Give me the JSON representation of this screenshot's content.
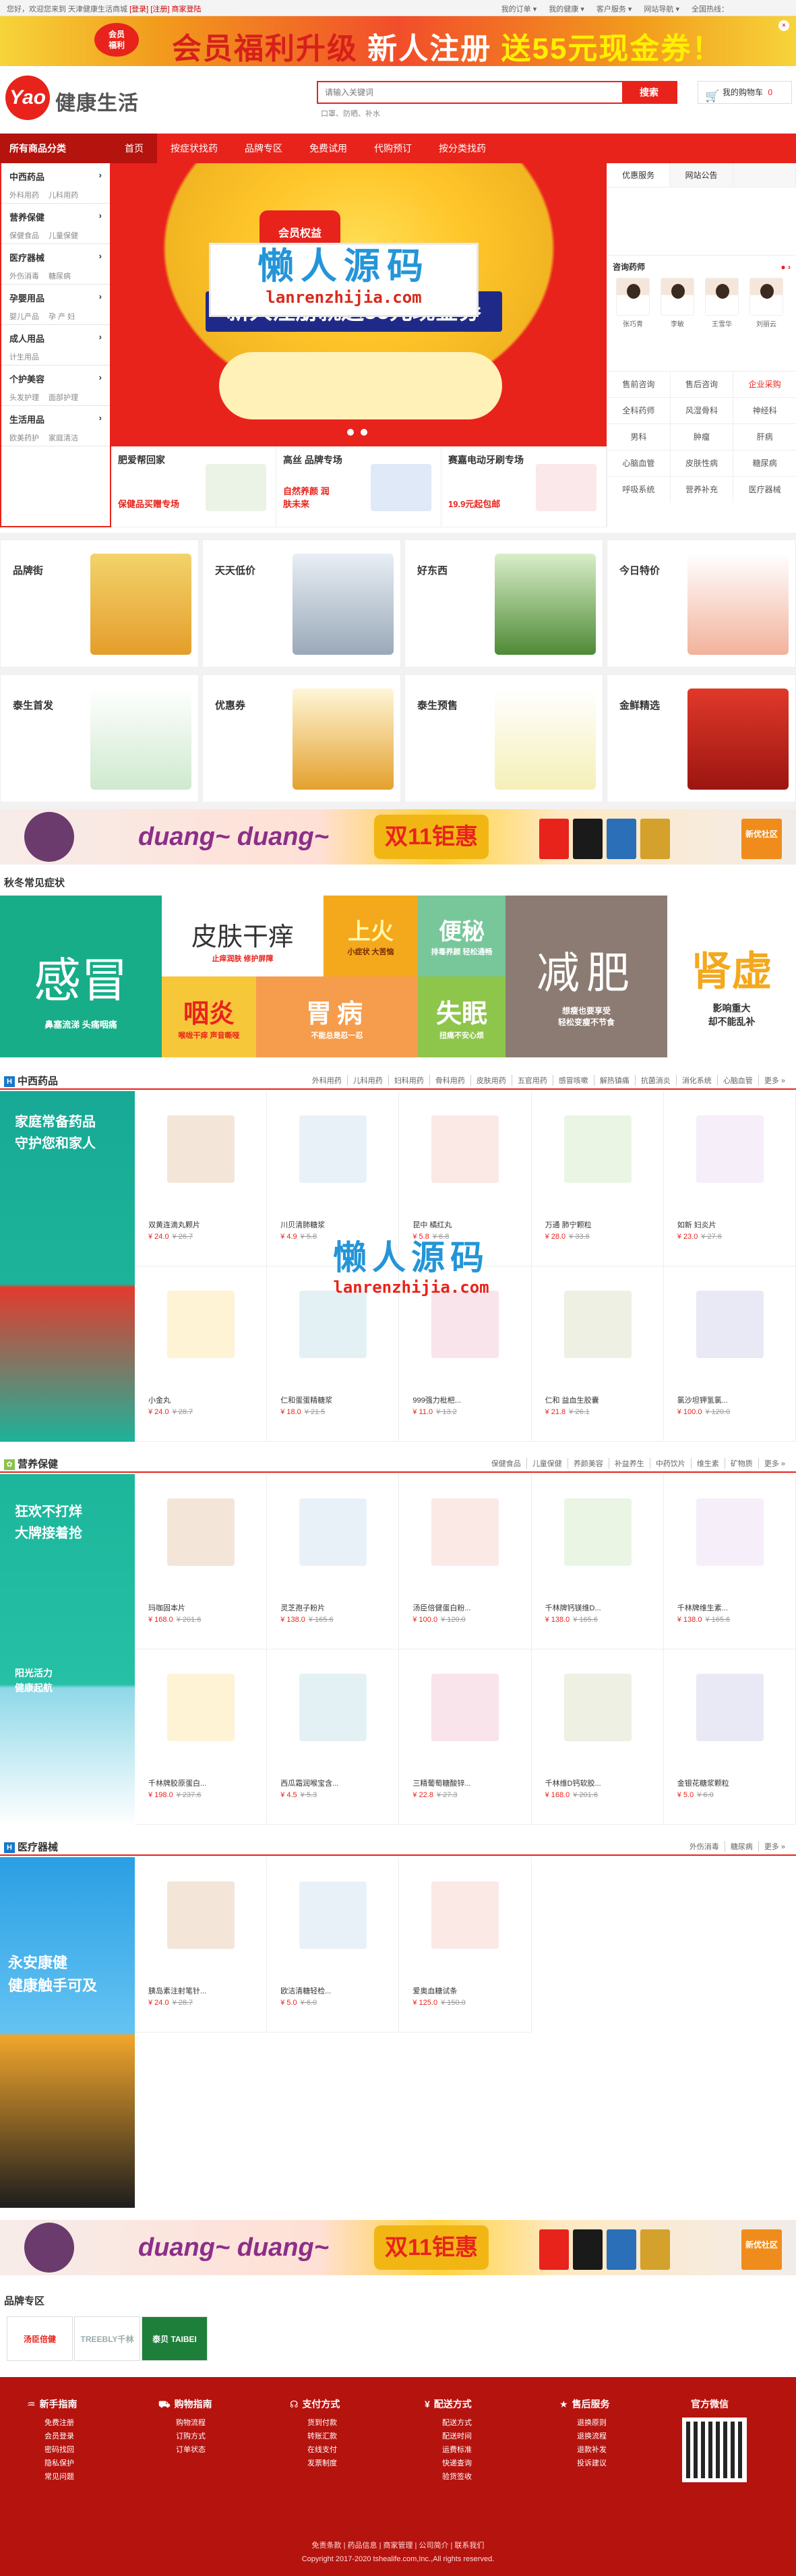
{
  "topbar": {
    "welcome_pre": "您好，欢迎您来到 天津健康生活商城 ",
    "login": "[登录]",
    "register": "[注册]",
    "home": "商家登陆",
    "links": [
      "我的订单 ▾",
      "我的健康 ▾",
      "客户服务 ▾",
      "网站导航 ▾",
      "全国热线："
    ]
  },
  "promo": {
    "badge": "会员\n福利",
    "text_a": "会员福利升级",
    "text_b": "新人注册",
    "text_c": "送55元现金券！",
    "close": "×"
  },
  "header": {
    "logo_mark": "Yao",
    "logo_text": "健康生活",
    "search_placeholder": "请输入关键词",
    "search_button": "搜索",
    "hot_words": "口罩、防晒、补水",
    "cart": "我的购物车",
    "cart_count": "0"
  },
  "nav": {
    "all": "所有商品分类",
    "items": [
      "首页",
      "按症状找药",
      "品牌专区",
      "免费试用",
      "代购预订",
      "按分类找药"
    ]
  },
  "sidebar": [
    {
      "title": "中西药品",
      "subs": [
        "外科用药",
        "儿科用药"
      ]
    },
    {
      "title": "营养保健",
      "subs": [
        "保健食品",
        "儿童保健"
      ]
    },
    {
      "title": "医疗器械",
      "subs": [
        "外伤消毒",
        "糖尿病"
      ]
    },
    {
      "title": "孕婴用品",
      "subs": [
        "婴儿产品",
        "孕 产 妇"
      ]
    },
    {
      "title": "成人用品",
      "subs": [
        "计生用品"
      ]
    },
    {
      "title": "个护美容",
      "subs": [
        "头发护理",
        "面部护理"
      ]
    },
    {
      "title": "生活用品",
      "subs": [
        "欧美药护",
        "家庭清洁"
      ]
    }
  ],
  "banner": {
    "ribbon": "会员权益\n大升级",
    "headline": "新人注册就送55元现金券",
    "watermark_cn": "懒人源码",
    "watermark_url": "lanrenzhijia.com"
  },
  "subbanners": [
    {
      "title": "肥爱帮回家",
      "desc": "保健品买赠专场"
    },
    {
      "title": "高丝 品牌专场",
      "desc": "自然养颜 润肤未来"
    },
    {
      "title": "赛嘉电动牙刷专场",
      "desc": "19.9元起包邮"
    }
  ],
  "rightpanel": {
    "tabs": [
      "优惠服务",
      "网站公告",
      ""
    ],
    "pharm_title": "咨询药师",
    "doctors": [
      "张巧青",
      "李敏",
      "王雪华",
      "刘丽云"
    ],
    "grid": [
      [
        "售前咨询",
        "售后咨询",
        "企业采购"
      ],
      [
        "全科药师",
        "风湿骨科",
        "神经科"
      ],
      [
        "男科",
        "肿瘤",
        "肝病"
      ],
      [
        "心脑血管",
        "皮肤性病",
        "糖尿病"
      ],
      [
        "呼吸系统",
        "营养补充",
        "医疗器械"
      ]
    ]
  },
  "channels": [
    {
      "title": "品牌街"
    },
    {
      "title": "天天低价"
    },
    {
      "title": "好东西"
    },
    {
      "title": "今日特价"
    },
    {
      "title": "泰生首发"
    },
    {
      "title": "优惠券"
    },
    {
      "title": "泰生预售"
    },
    {
      "title": "金鲜精选"
    }
  ],
  "banner2": {
    "text": "duang~ duang~",
    "big": "双11钜惠",
    "tag": "新优社区"
  },
  "autumn": {
    "title": "秋冬常见症状",
    "blocks": [
      {
        "name": "感冒",
        "sub": "鼻塞流涕 头痛咽痛"
      },
      {
        "name": "皮肤干痒",
        "sub": "止痒润肤 修护屏障"
      },
      {
        "name": "上火",
        "sub": "小症状 大苦恼"
      },
      {
        "name": "便秘",
        "sub": "排毒养颜 轻松通畅"
      },
      {
        "name": "减肥",
        "sub": "想瘦也要享受\n轻松变瘦不节食"
      },
      {
        "name": "肾虚",
        "sub": "影响重大\n却不能乱补"
      },
      {
        "name": "咽炎",
        "sub": "喉咙干痒 声音嘶哑"
      },
      {
        "name": "胃病",
        "sub": "不能总是忍一忍"
      },
      {
        "name": "失眠",
        "sub": "扭痛不安心烦"
      }
    ]
  },
  "sec_cn": {
    "title": "中西药品",
    "icon": "H",
    "links": [
      "外科用药",
      "儿科用药",
      "妇科用药",
      "骨科用药",
      "皮肤用药",
      "五官用药",
      "感冒咳嗽",
      "解热镇痛",
      "抗菌消炎",
      "消化系统",
      "心脑血管",
      "更多 »"
    ],
    "banner": "家庭常备药品\n守护您和家人",
    "products": [
      {
        "name": "双黄连滴丸颗片",
        "price": "¥ 24.0",
        "old": "¥ 26.7"
      },
      {
        "name": "川贝清肺糖浆",
        "price": "¥ 4.9",
        "old": "¥ 5.8"
      },
      {
        "name": "昆中 橘红丸",
        "price": "¥ 5.8",
        "old": "¥ 6.8"
      },
      {
        "name": "万通 肺宁颗粒",
        "price": "¥ 28.0",
        "old": "¥ 33.6"
      },
      {
        "name": "如新 妇炎片",
        "price": "¥ 23.0",
        "old": "¥ 27.6"
      },
      {
        "name": "小金丸",
        "price": "¥ 24.0",
        "old": "¥ 28.7"
      },
      {
        "name": "仁和蛋蛋精糖浆",
        "price": "¥ 18.0",
        "old": "¥ 21.5"
      },
      {
        "name": "999强力枇杷...",
        "price": "¥ 11.0",
        "old": "¥ 13.2"
      },
      {
        "name": "仁和 益血生胶囊",
        "price": "¥ 21.8",
        "old": "¥ 26.1"
      },
      {
        "name": "氯沙坦钾氢氯...",
        "price": "¥ 100.0",
        "old": "¥ 120.0"
      }
    ]
  },
  "sec_yy": {
    "title": "营养保健",
    "links": [
      "保健食品",
      "儿童保健",
      "养颜美容",
      "补益养生",
      "中药饮片",
      "维生素",
      "矿物质",
      "更多 »"
    ],
    "banner_top": "狂欢不打烊\n大牌接着抢",
    "banner_bot": "阳光活力\n健康起航",
    "products": [
      {
        "name": "玛咖固本片",
        "price": "¥ 168.0",
        "old": "¥ 201.6"
      },
      {
        "name": "灵芝孢子粉片",
        "price": "¥ 138.0",
        "old": "¥ 165.6"
      },
      {
        "name": "汤臣倍健蛋白粉...",
        "price": "¥ 100.0",
        "old": "¥ 120.0"
      },
      {
        "name": "千林牌钙镁维D...",
        "price": "¥ 138.0",
        "old": "¥ 165.6"
      },
      {
        "name": "千林牌维生素...",
        "price": "¥ 138.0",
        "old": "¥ 165.6"
      },
      {
        "name": "千林牌胶原蛋白...",
        "price": "¥ 198.0",
        "old": "¥ 237.6"
      },
      {
        "name": "西瓜霜润喉宝含...",
        "price": "¥ 4.5",
        "old": "¥ 5.3"
      },
      {
        "name": "三精葡萄糖酸锌...",
        "price": "¥ 22.8",
        "old": "¥ 27.3"
      },
      {
        "name": "千林维D钙软胶...",
        "price": "¥ 168.0",
        "old": "¥ 201.6"
      },
      {
        "name": "金银花糖浆颗粒",
        "price": "¥ 5.0",
        "old": "¥ 6.0"
      }
    ]
  },
  "sec_yl": {
    "title": "医疗器械",
    "icon": "H",
    "links": [
      "外伤消毒",
      "糖尿病",
      "更多 »"
    ],
    "banner": "永安康健\n健康触手可及",
    "products": [
      {
        "name": "胰岛素注射笔针...",
        "price": "¥ 24.0",
        "old": "¥ 28.7"
      },
      {
        "name": "欧洁清糖轻检...",
        "price": "¥ 5.0",
        "old": "¥ 6.0"
      },
      {
        "name": "爱奥血糖试条",
        "price": "¥ 125.0",
        "old": "¥ 150.0"
      }
    ]
  },
  "brand": {
    "title": "品牌专区",
    "logos": [
      "汤臣倍健",
      "TREEBLY千林",
      "泰贝 TAIBEI"
    ]
  },
  "footer": {
    "cols": [
      {
        "icon": "♒",
        "title": "新手指南",
        "items": [
          "免费注册",
          "会员登录",
          "密码找回",
          "隐私保护",
          "常见问题"
        ]
      },
      {
        "icon": "⛟",
        "title": "购物指南",
        "items": [
          "购物流程",
          "订购方式",
          "订单状态"
        ]
      },
      {
        "icon": "☊",
        "title": "支付方式",
        "items": [
          "货到付款",
          "转账汇款",
          "在线支付",
          "发票制度"
        ]
      },
      {
        "icon": "¥",
        "title": "配送方式",
        "items": [
          "配送方式",
          "配送时间",
          "运费标准",
          "快递查询",
          "验货签收"
        ]
      },
      {
        "icon": "★",
        "title": "售后服务",
        "items": [
          "退换原则",
          "退换流程",
          "退款补发",
          "投诉建议"
        ]
      },
      {
        "icon": "",
        "title": "官方微信",
        "items": []
      }
    ],
    "links": "免责条款 | 药品信息 | 商家管理 | 公司简介 | 联系我们",
    "copyright": "Copyright 2017-2020 tshealife.com,Inc.,All rights reserved."
  },
  "colors": {
    "brand": "#e8231c",
    "dark": "#b5130e",
    "link": "#2495d8"
  }
}
